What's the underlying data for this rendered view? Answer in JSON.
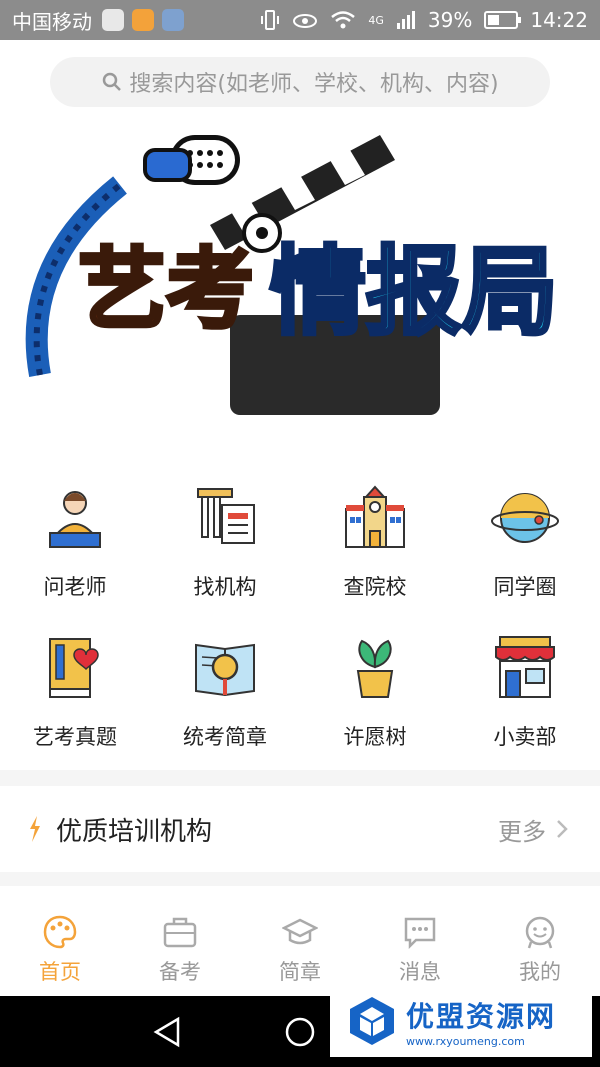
{
  "status_bar": {
    "carrier": "中国移动",
    "network": "4G",
    "battery": "39%",
    "battery_level": 0.39,
    "time": "14:22"
  },
  "search": {
    "placeholder": "搜索内容(如老师、学校、机构、内容)",
    "icon": "search-icon"
  },
  "banner": {
    "title_left": "艺考",
    "title_right": "情报局"
  },
  "grid": {
    "row1": [
      {
        "label": "问老师",
        "icon": "teacher-icon"
      },
      {
        "label": "找机构",
        "icon": "institution-icon"
      },
      {
        "label": "查院校",
        "icon": "school-icon"
      },
      {
        "label": "同学圈",
        "icon": "planet-icon"
      }
    ],
    "row2": [
      {
        "label": "艺考真题",
        "icon": "exam-book-icon"
      },
      {
        "label": "统考简章",
        "icon": "magnifier-book-icon"
      },
      {
        "label": "许愿树",
        "icon": "plant-icon"
      },
      {
        "label": "小卖部",
        "icon": "shop-icon"
      }
    ]
  },
  "section": {
    "title": "优质培训机构",
    "more": "更多"
  },
  "tabbar": [
    {
      "label": "首页",
      "icon": "palette-icon",
      "active": true
    },
    {
      "label": "备考",
      "icon": "briefcase-icon",
      "active": false
    },
    {
      "label": "简章",
      "icon": "graduation-cap-icon",
      "active": false
    },
    {
      "label": "消息",
      "icon": "message-icon",
      "active": false
    },
    {
      "label": "我的",
      "icon": "profile-icon",
      "active": false
    }
  ],
  "watermark": {
    "title": "优盟资源网",
    "url": "www.rxyoumeng.com"
  },
  "colors": {
    "accent": "#f4a33a",
    "status_bar": "#8c8c8c",
    "watermark_blue": "#1664c6"
  }
}
